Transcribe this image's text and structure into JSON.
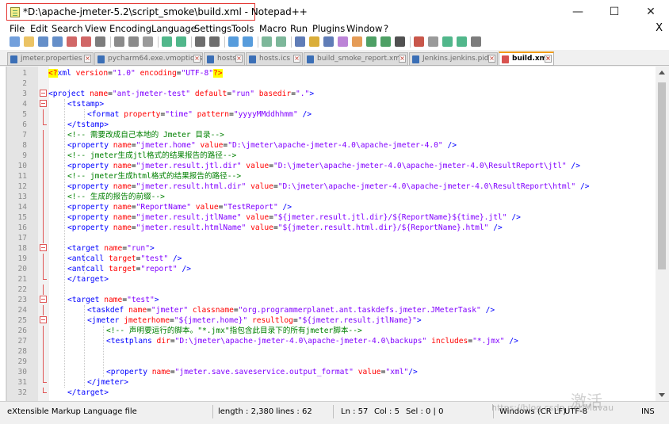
{
  "window": {
    "title": "*D:\\apache-jmeter-5.2\\script_smoke\\build.xml - Notepad++",
    "minimize": "—",
    "maximize": "☐",
    "close": "✕"
  },
  "menu": {
    "items": [
      "File",
      "Edit",
      "Search",
      "View",
      "Encoding",
      "Language",
      "Settings",
      "Tools",
      "Macro",
      "Run",
      "Plugins",
      "Window",
      "?"
    ],
    "close": "X"
  },
  "toolbar": {
    "icons": [
      "new-icon",
      "open-icon",
      "save-icon",
      "save-all-icon",
      "close-icon",
      "close-all-icon",
      "print-icon",
      "cut-icon",
      "copy-icon",
      "paste-icon",
      "undo-icon",
      "redo-icon",
      "find-icon",
      "replace-icon",
      "zoom-in-icon",
      "zoom-out-icon",
      "sync-vertical-icon",
      "sync-horizontal-icon",
      "word-wrap-icon",
      "show-all-chars-icon",
      "indent-guide-icon",
      "udl-icon",
      "doc-map-icon",
      "function-list-icon",
      "folder-workspace-icon",
      "monitor-icon",
      "record-macro-icon",
      "stop-macro-icon",
      "play-macro-icon",
      "run-macro-multiple-icon",
      "save-macro-icon"
    ]
  },
  "tabs": [
    {
      "label": "jmeter.properties",
      "active": false
    },
    {
      "label": "pycharm64.exe.vmoptions",
      "active": false
    },
    {
      "label": "hosts",
      "active": false
    },
    {
      "label": "hosts.ics",
      "active": false
    },
    {
      "label": "build_smoke_report.xml",
      "active": false
    },
    {
      "label": "Jenkins.jenkins.pid",
      "active": false
    },
    {
      "label": "build.xml",
      "active": true
    }
  ],
  "colors": {
    "tag": "#0000ff",
    "attribute": "#ff0000",
    "value": "#8000ff",
    "comment": "#008000",
    "highlight": "#ffff00",
    "active_tab_accent": "#f39c12",
    "title_highlight_box": "#e53935"
  },
  "lines": [
    {
      "n": "1",
      "fold": "",
      "indent": 0,
      "tokens": [
        [
          "hl",
          "<?"
        ],
        [
          "tag",
          "xml"
        ],
        [
          "plain",
          " "
        ],
        [
          "attr",
          "version"
        ],
        [
          "plain",
          "="
        ],
        [
          "val",
          "\"1.0\""
        ],
        [
          "plain",
          " "
        ],
        [
          "attr",
          "encoding"
        ],
        [
          "plain",
          "="
        ],
        [
          "val",
          "\"UTF-8\""
        ],
        [
          "hl",
          "?>"
        ]
      ]
    },
    {
      "n": "2",
      "fold": "",
      "indent": 0,
      "tokens": []
    },
    {
      "n": "3",
      "fold": "box",
      "indent": 0,
      "tokens": [
        [
          "tag",
          "<project"
        ],
        [
          "plain",
          " "
        ],
        [
          "attr",
          "name"
        ],
        [
          "plain",
          "="
        ],
        [
          "val",
          "\"ant-jmeter-test\""
        ],
        [
          "plain",
          " "
        ],
        [
          "attr",
          "default"
        ],
        [
          "plain",
          "="
        ],
        [
          "val",
          "\"run\""
        ],
        [
          "plain",
          " "
        ],
        [
          "attr",
          "basedir"
        ],
        [
          "plain",
          "="
        ],
        [
          "val",
          "\".\""
        ],
        [
          "tag",
          ">"
        ]
      ]
    },
    {
      "n": "4",
      "fold": "box",
      "indent": 1,
      "tokens": [
        [
          "tag",
          "<tstamp>"
        ]
      ]
    },
    {
      "n": "5",
      "fold": "vl",
      "indent": 2,
      "tokens": [
        [
          "tag",
          "<format"
        ],
        [
          "plain",
          " "
        ],
        [
          "attr",
          "property"
        ],
        [
          "plain",
          "="
        ],
        [
          "val",
          "\"time\""
        ],
        [
          "plain",
          " "
        ],
        [
          "attr",
          "pattern"
        ],
        [
          "plain",
          "="
        ],
        [
          "val",
          "\"yyyyMMddhhmm\""
        ],
        [
          "plain",
          " "
        ],
        [
          "tag",
          "/>"
        ]
      ]
    },
    {
      "n": "6",
      "fold": "end",
      "indent": 1,
      "tokens": [
        [
          "tag",
          "</tstamp>"
        ]
      ]
    },
    {
      "n": "7",
      "fold": "vl",
      "indent": 1,
      "tokens": [
        [
          "cmt",
          "<!-- 需要改成自己本地的 Jmeter 目录-->"
        ]
      ]
    },
    {
      "n": "8",
      "fold": "vl",
      "indent": 1,
      "tokens": [
        [
          "tag",
          "<property"
        ],
        [
          "plain",
          " "
        ],
        [
          "attr",
          "name"
        ],
        [
          "plain",
          "="
        ],
        [
          "val",
          "\"jmeter.home\""
        ],
        [
          "plain",
          " "
        ],
        [
          "attr",
          "value"
        ],
        [
          "plain",
          "="
        ],
        [
          "val",
          "\"D:\\jmeter\\apache-jmeter-4.0\\apache-jmeter-4.0\""
        ],
        [
          "plain",
          " "
        ],
        [
          "tag",
          "/>"
        ]
      ]
    },
    {
      "n": "9",
      "fold": "vl",
      "indent": 1,
      "tokens": [
        [
          "cmt",
          "<!-- jmeter生成jtl格式的结果报告的路径-->"
        ]
      ]
    },
    {
      "n": "10",
      "fold": "vl",
      "indent": 1,
      "tokens": [
        [
          "tag",
          "<property"
        ],
        [
          "plain",
          " "
        ],
        [
          "attr",
          "name"
        ],
        [
          "plain",
          "="
        ],
        [
          "val",
          "\"jmeter.result.jtl.dir\""
        ],
        [
          "plain",
          " "
        ],
        [
          "attr",
          "value"
        ],
        [
          "plain",
          "="
        ],
        [
          "val",
          "\"D:\\jmeter\\apache-jmeter-4.0\\apache-jmeter-4.0\\ResultReport\\jtl\""
        ],
        [
          "plain",
          " "
        ],
        [
          "tag",
          "/>"
        ]
      ]
    },
    {
      "n": "11",
      "fold": "vl",
      "indent": 1,
      "tokens": [
        [
          "cmt",
          "<!-- jmeter生成html格式的结果报告的路径-->"
        ]
      ]
    },
    {
      "n": "12",
      "fold": "vl",
      "indent": 1,
      "tokens": [
        [
          "tag",
          "<property"
        ],
        [
          "plain",
          " "
        ],
        [
          "attr",
          "name"
        ],
        [
          "plain",
          "="
        ],
        [
          "val",
          "\"jmeter.result.html.dir\""
        ],
        [
          "plain",
          " "
        ],
        [
          "attr",
          "value"
        ],
        [
          "plain",
          "="
        ],
        [
          "val",
          "\"D:\\jmeter\\apache-jmeter-4.0\\apache-jmeter-4.0\\ResultReport\\html\""
        ],
        [
          "plain",
          " "
        ],
        [
          "tag",
          "/>"
        ]
      ]
    },
    {
      "n": "13",
      "fold": "vl",
      "indent": 1,
      "tokens": [
        [
          "cmt",
          "<!-- 生成的报告的前缀-->"
        ]
      ]
    },
    {
      "n": "14",
      "fold": "vl",
      "indent": 1,
      "tokens": [
        [
          "tag",
          "<property"
        ],
        [
          "plain",
          " "
        ],
        [
          "attr",
          "name"
        ],
        [
          "plain",
          "="
        ],
        [
          "val",
          "\"ReportName\""
        ],
        [
          "plain",
          " "
        ],
        [
          "attr",
          "value"
        ],
        [
          "plain",
          "="
        ],
        [
          "val",
          "\"TestReport\""
        ],
        [
          "plain",
          " "
        ],
        [
          "tag",
          "/>"
        ]
      ]
    },
    {
      "n": "15",
      "fold": "vl",
      "indent": 1,
      "tokens": [
        [
          "tag",
          "<property"
        ],
        [
          "plain",
          " "
        ],
        [
          "attr",
          "name"
        ],
        [
          "plain",
          "="
        ],
        [
          "val",
          "\"jmeter.result.jtlName\""
        ],
        [
          "plain",
          " "
        ],
        [
          "attr",
          "value"
        ],
        [
          "plain",
          "="
        ],
        [
          "val",
          "\"${jmeter.result.jtl.dir}/${ReportName}${time}.jtl\""
        ],
        [
          "plain",
          " "
        ],
        [
          "tag",
          "/>"
        ]
      ]
    },
    {
      "n": "16",
      "fold": "vl",
      "indent": 1,
      "tokens": [
        [
          "tag",
          "<property"
        ],
        [
          "plain",
          " "
        ],
        [
          "attr",
          "name"
        ],
        [
          "plain",
          "="
        ],
        [
          "val",
          "\"jmeter.result.htmlName\""
        ],
        [
          "plain",
          " "
        ],
        [
          "attr",
          "value"
        ],
        [
          "plain",
          "="
        ],
        [
          "val",
          "\"${jmeter.result.html.dir}/${ReportName}.html\""
        ],
        [
          "plain",
          " "
        ],
        [
          "tag",
          "/>"
        ]
      ]
    },
    {
      "n": "17",
      "fold": "vl",
      "indent": 0,
      "tokens": []
    },
    {
      "n": "18",
      "fold": "box",
      "indent": 1,
      "tokens": [
        [
          "tag",
          "<target"
        ],
        [
          "plain",
          " "
        ],
        [
          "attr",
          "name"
        ],
        [
          "plain",
          "="
        ],
        [
          "val",
          "\"run\""
        ],
        [
          "tag",
          ">"
        ]
      ]
    },
    {
      "n": "19",
      "fold": "vl",
      "indent": 1,
      "tokens": [
        [
          "tag",
          "<antcall"
        ],
        [
          "plain",
          " "
        ],
        [
          "attr",
          "target"
        ],
        [
          "plain",
          "="
        ],
        [
          "val",
          "\"test\""
        ],
        [
          "plain",
          " "
        ],
        [
          "tag",
          "/>"
        ]
      ]
    },
    {
      "n": "20",
      "fold": "vl",
      "indent": 1,
      "tokens": [
        [
          "tag",
          "<antcall"
        ],
        [
          "plain",
          " "
        ],
        [
          "attr",
          "target"
        ],
        [
          "plain",
          "="
        ],
        [
          "val",
          "\"report\""
        ],
        [
          "plain",
          " "
        ],
        [
          "tag",
          "/>"
        ]
      ]
    },
    {
      "n": "21",
      "fold": "end",
      "indent": 1,
      "tokens": [
        [
          "tag",
          "</target>"
        ]
      ]
    },
    {
      "n": "22",
      "fold": "vl",
      "indent": 0,
      "tokens": []
    },
    {
      "n": "23",
      "fold": "box",
      "indent": 1,
      "tokens": [
        [
          "tag",
          "<target"
        ],
        [
          "plain",
          " "
        ],
        [
          "attr",
          "name"
        ],
        [
          "plain",
          "="
        ],
        [
          "val",
          "\"test\""
        ],
        [
          "tag",
          ">"
        ]
      ]
    },
    {
      "n": "24",
      "fold": "vl",
      "indent": 2,
      "tokens": [
        [
          "tag",
          "<taskdef"
        ],
        [
          "plain",
          " "
        ],
        [
          "attr",
          "name"
        ],
        [
          "plain",
          "="
        ],
        [
          "val",
          "\"jmeter\""
        ],
        [
          "plain",
          " "
        ],
        [
          "attr",
          "classname"
        ],
        [
          "plain",
          "="
        ],
        [
          "val",
          "\"org.programmerplanet.ant.taskdefs.jmeter.JMeterTask\""
        ],
        [
          "plain",
          " "
        ],
        [
          "tag",
          "/>"
        ]
      ]
    },
    {
      "n": "25",
      "fold": "box",
      "indent": 2,
      "tokens": [
        [
          "tag",
          "<jmeter"
        ],
        [
          "plain",
          " "
        ],
        [
          "attr",
          "jmeterhome"
        ],
        [
          "plain",
          "="
        ],
        [
          "val",
          "\"${jmeter.home}\""
        ],
        [
          "plain",
          " "
        ],
        [
          "attr",
          "resultlog"
        ],
        [
          "plain",
          "="
        ],
        [
          "val",
          "\"${jmeter.result.jtlName}\""
        ],
        [
          "tag",
          ">"
        ]
      ]
    },
    {
      "n": "26",
      "fold": "vl",
      "indent": 3,
      "tokens": [
        [
          "cmt",
          "<!-- 声明要运行的脚本。\"*.jmx\"指包含此目录下的所有jmeter脚本-->"
        ]
      ]
    },
    {
      "n": "27",
      "fold": "vl",
      "indent": 3,
      "tokens": [
        [
          "tag",
          "<testplans"
        ],
        [
          "plain",
          " "
        ],
        [
          "attr",
          "dir"
        ],
        [
          "plain",
          "="
        ],
        [
          "val",
          "\"D:\\jmeter\\apache-jmeter-4.0\\apache-jmeter-4.0\\backups\""
        ],
        [
          "plain",
          " "
        ],
        [
          "attr",
          "includes"
        ],
        [
          "plain",
          "="
        ],
        [
          "val",
          "\"*.jmx\""
        ],
        [
          "plain",
          " "
        ],
        [
          "tag",
          "/>"
        ]
      ]
    },
    {
      "n": "28",
      "fold": "vl",
      "indent": 0,
      "tokens": []
    },
    {
      "n": "29",
      "fold": "vl",
      "indent": 0,
      "tokens": []
    },
    {
      "n": "30",
      "fold": "vl",
      "indent": 3,
      "tokens": [
        [
          "tag",
          "<property"
        ],
        [
          "plain",
          " "
        ],
        [
          "attr",
          "name"
        ],
        [
          "plain",
          "="
        ],
        [
          "val",
          "\"jmeter.save.saveservice.output_format\""
        ],
        [
          "plain",
          " "
        ],
        [
          "attr",
          "value"
        ],
        [
          "plain",
          "="
        ],
        [
          "val",
          "\"xml\""
        ],
        [
          "tag",
          "/>"
        ]
      ]
    },
    {
      "n": "31",
      "fold": "end",
      "indent": 2,
      "tokens": [
        [
          "tag",
          "</jmeter>"
        ]
      ]
    },
    {
      "n": "32",
      "fold": "end",
      "indent": 1,
      "tokens": [
        [
          "tag",
          "</target>"
        ]
      ]
    }
  ],
  "status": {
    "file_type": "eXtensible Markup Language file",
    "length": "length : 2,380",
    "lines": "lines : 62",
    "ln": "Ln : 57",
    "col": "Col : 5",
    "sel": "Sel : 0 | 0",
    "eol": "Windows (CR LF)",
    "encoding": "UTF-8",
    "mode": "INS"
  },
  "watermark": {
    "mark": "激活",
    "url": "https://blog.csdn.net/Mavau"
  }
}
